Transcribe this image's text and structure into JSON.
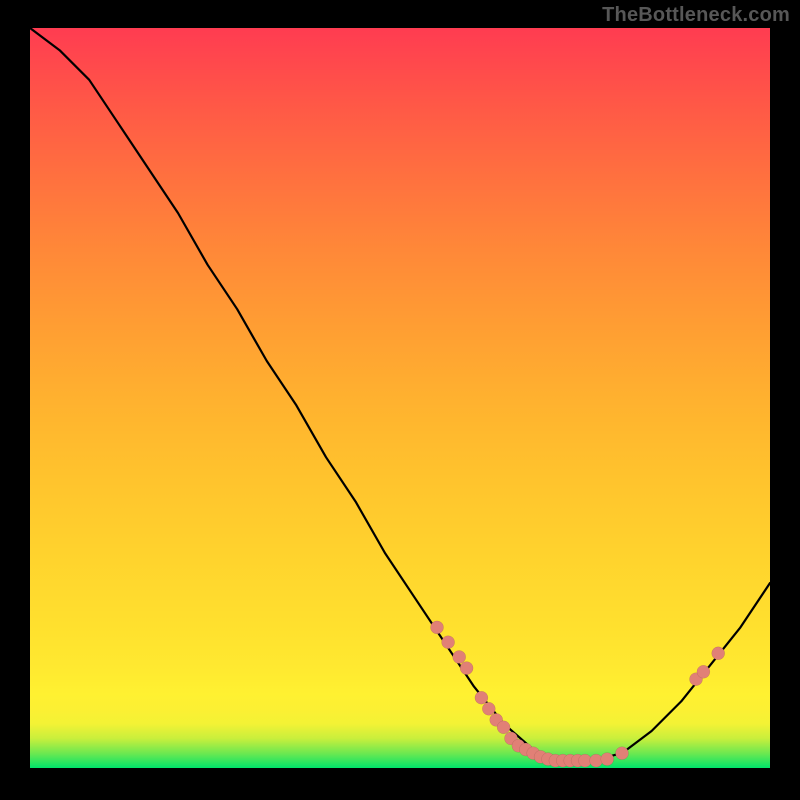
{
  "watermark": "TheBottleneck.com",
  "colors": {
    "background": "#000000",
    "watermark_text": "#575757",
    "curve_stroke": "#000000",
    "dot_fill": "#e18076",
    "gradient_top": "#ff3c51",
    "gradient_bottom": "#00e46a"
  },
  "chart_data": {
    "type": "line",
    "title": "",
    "xlabel": "",
    "ylabel": "",
    "xlim": [
      0,
      100
    ],
    "ylim": [
      0,
      100
    ],
    "grid": false,
    "legend": "none",
    "x": [
      0,
      4,
      8,
      12,
      16,
      20,
      24,
      28,
      32,
      36,
      40,
      44,
      48,
      52,
      56,
      60,
      64,
      68,
      72,
      76,
      80,
      84,
      88,
      92,
      96,
      100
    ],
    "values": [
      100,
      97,
      93,
      87,
      81,
      75,
      68,
      62,
      55,
      49,
      42,
      36,
      29,
      23,
      17,
      11,
      6,
      2.5,
      1,
      1,
      2,
      5,
      9,
      14,
      19,
      25
    ],
    "annotations": [
      {
        "x": 55,
        "y": 19,
        "type": "dot"
      },
      {
        "x": 56.5,
        "y": 17,
        "type": "dot"
      },
      {
        "x": 58,
        "y": 15,
        "type": "dot"
      },
      {
        "x": 59,
        "y": 13.5,
        "type": "dot"
      },
      {
        "x": 61,
        "y": 9.5,
        "type": "dot"
      },
      {
        "x": 62,
        "y": 8,
        "type": "dot"
      },
      {
        "x": 63,
        "y": 6.5,
        "type": "dot"
      },
      {
        "x": 64,
        "y": 5.5,
        "type": "dot"
      },
      {
        "x": 65,
        "y": 4,
        "type": "dot"
      },
      {
        "x": 66,
        "y": 3,
        "type": "dot"
      },
      {
        "x": 67,
        "y": 2.5,
        "type": "dot"
      },
      {
        "x": 68,
        "y": 2,
        "type": "dot"
      },
      {
        "x": 69,
        "y": 1.5,
        "type": "dot"
      },
      {
        "x": 70,
        "y": 1.2,
        "type": "dot"
      },
      {
        "x": 71,
        "y": 1,
        "type": "dot"
      },
      {
        "x": 72,
        "y": 1,
        "type": "dot"
      },
      {
        "x": 73,
        "y": 1,
        "type": "dot"
      },
      {
        "x": 74,
        "y": 1,
        "type": "dot"
      },
      {
        "x": 75,
        "y": 1,
        "type": "dot"
      },
      {
        "x": 76.5,
        "y": 1,
        "type": "dot"
      },
      {
        "x": 78,
        "y": 1.2,
        "type": "dot"
      },
      {
        "x": 80,
        "y": 2,
        "type": "dot"
      },
      {
        "x": 90,
        "y": 12,
        "type": "dot"
      },
      {
        "x": 91,
        "y": 13,
        "type": "dot"
      },
      {
        "x": 93,
        "y": 15.5,
        "type": "dot"
      }
    ]
  }
}
